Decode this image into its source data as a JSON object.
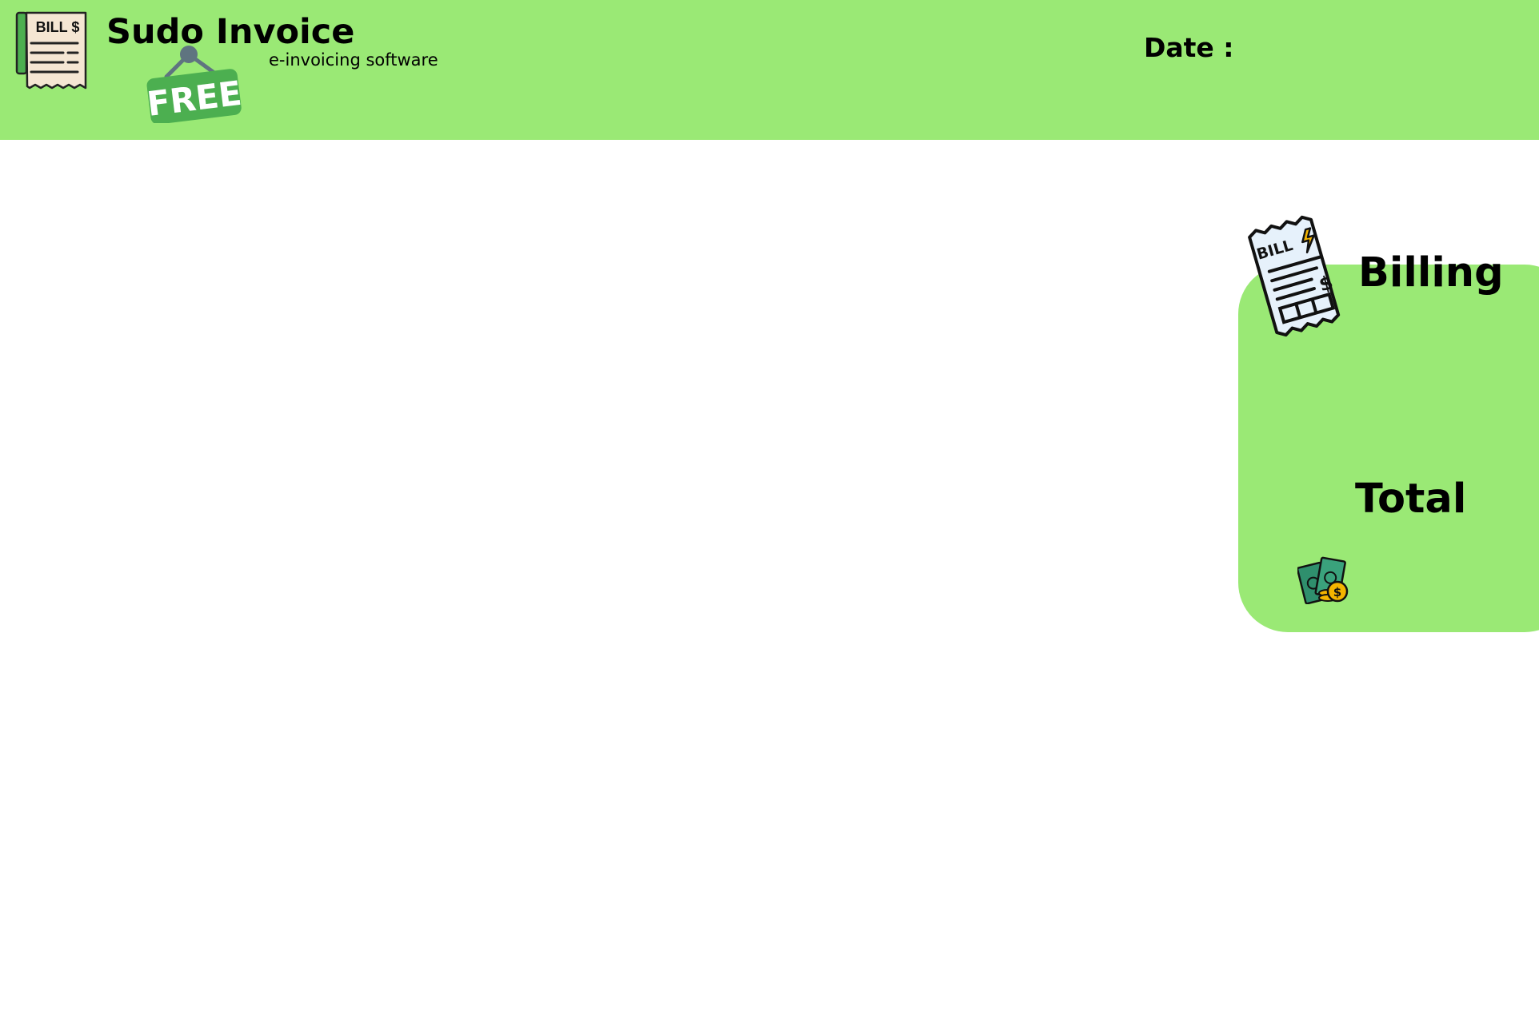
{
  "header": {
    "title": "Sudo Invoice",
    "subtitle": "e-invoicing software",
    "date_label": "Date :",
    "logo_icon": "bill-receipt-icon",
    "logo_text": "BILL $",
    "badge_icon": "free-sign-icon",
    "badge_text": "FREE"
  },
  "billing": {
    "title": "Billing",
    "total_label": "Total",
    "bill_icon": "bill-paper-icon",
    "bill_icon_text": "BILL",
    "money_icon": "money-coins-icon"
  },
  "colors": {
    "accent": "#9ae975",
    "free_badge": "#4caf50",
    "background": "#ffffff"
  }
}
